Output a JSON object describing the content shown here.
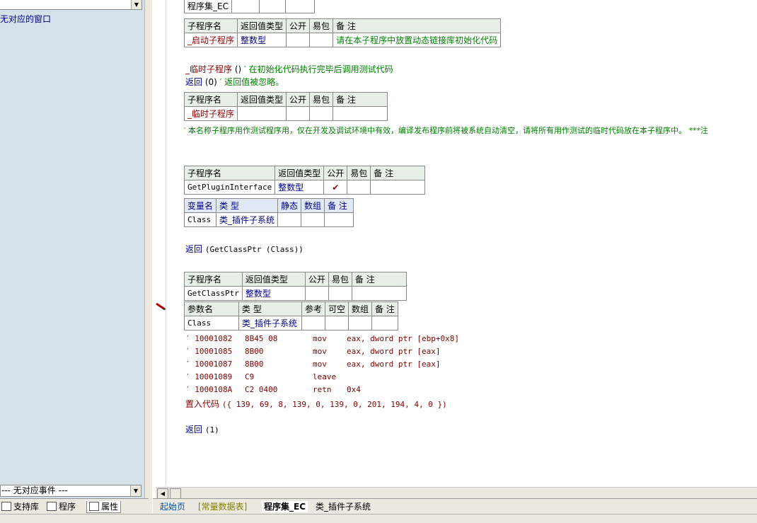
{
  "left_panel": {
    "top_combo_value": "",
    "tree_text": "无对应的窗口",
    "event_combo": "--- 无对应事件 ---",
    "tabs": [
      {
        "label": "支持库",
        "icon": "library-icon"
      },
      {
        "label": "程序",
        "icon": "program-icon"
      },
      {
        "label": "属性",
        "icon": "property-icon"
      }
    ]
  },
  "editor": {
    "assembly_table": {
      "cell": "程序集_EC"
    },
    "sub1": {
      "headers": [
        "子程序名",
        "返回值类型",
        "公开",
        "易包",
        "备 注"
      ],
      "row": [
        "_启动子程序",
        "整数型",
        "",
        "",
        "请在本子程序中放置动态链接库初始化代码"
      ]
    },
    "temp_sub_line": {
      "name": "_临时子程序",
      "parens": "()",
      "comment": "′ 在初始化代码执行完毕后调用测试代码"
    },
    "return0_line": {
      "kw": "返回",
      "args": "(0)",
      "comment": "′ 返回值被忽略。"
    },
    "sub2": {
      "headers": [
        "子程序名",
        "返回值类型",
        "公开",
        "易包",
        "备 注"
      ],
      "row": [
        "_临时子程序",
        "",
        "",
        "",
        ""
      ]
    },
    "long_comment": "′ 本名称子程序用作测试程序用，仅在开发及调试环境中有效，编译发布程序前将被系统自动清空，请将所有用作测试的临时代码放在本子程序中。 ***注",
    "sub3": {
      "headers": [
        "子程序名",
        "返回值类型",
        "公开",
        "易包",
        "备 注"
      ],
      "row": [
        "GetPluginInterface",
        "整数型",
        "✔",
        "",
        ""
      ]
    },
    "var_table": {
      "headers": [
        "变量名",
        "类 型",
        "静态",
        "数组",
        "备 注"
      ],
      "row": [
        "Class",
        "类_插件子系统",
        "",
        "",
        ""
      ]
    },
    "return_getclassptr": {
      "kw": "返回",
      "args": "(GetClassPtr (Class))"
    },
    "sub4": {
      "headers": [
        "子程序名",
        "返回值类型",
        "公开",
        "易包",
        "备 注"
      ],
      "row": [
        "GetClassPtr",
        "整数型",
        "",
        "",
        ""
      ]
    },
    "param_table": {
      "headers": [
        "参数名",
        "类 型",
        "参考",
        "可空",
        "数组",
        "备 注"
      ],
      "row": [
        "Class",
        "类_插件子系统",
        "",
        "",
        "",
        ""
      ]
    },
    "asm_lines": [
      {
        "addr": "′ 10001082",
        "bytes": "8B45 08",
        "op": "mov",
        "args": "eax, dword ptr [ebp+0x8]"
      },
      {
        "addr": "′ 10001085",
        "bytes": "8B00",
        "op": "mov",
        "args": "eax, dword ptr [eax]"
      },
      {
        "addr": "′ 10001087",
        "bytes": "8B00",
        "op": "mov",
        "args": "eax, dword ptr [eax]"
      },
      {
        "addr": "′ 10001089",
        "bytes": "C9",
        "op": "leave",
        "args": ""
      },
      {
        "addr": "′ 1000108A",
        "bytes": "C2 0400",
        "op": "retn",
        "args": "0x4"
      }
    ],
    "embed_line": {
      "kw": "置入代码",
      "args": "({ 139, 69, 8, 139, 0, 139, 0, 201, 194, 4, 0 })"
    },
    "return1_line": {
      "kw": "返回",
      "args": "(1)"
    }
  },
  "doc_tabs": [
    "起始页",
    "[常量数据表]",
    "程序集_EC",
    "类_插件子系统"
  ],
  "colors": {
    "keyword": "#00008b",
    "comment": "#008000",
    "subname": "#8b0000",
    "panel": "#d6e0e8"
  }
}
